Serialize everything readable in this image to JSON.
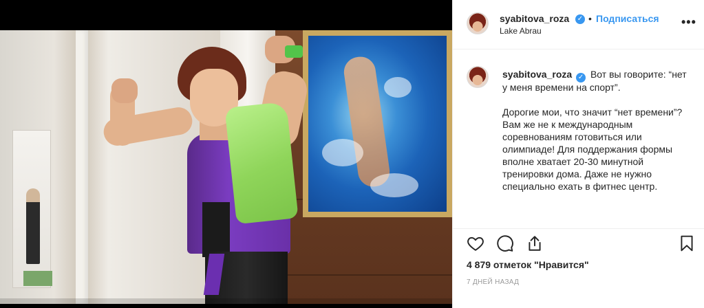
{
  "post": {
    "header": {
      "username": "syabitova_roza",
      "verified_mark": "✓",
      "separator": "•",
      "follow_label": "Подписаться",
      "location": "Lake Abrau",
      "more_label": "•••"
    },
    "caption": {
      "username": "syabitova_roza",
      "first_line": "Вот вы говорите: “нет у меня времени на спорт”.",
      "body": "Дорогие мои, что значит “нет времени”? Вам же не к международным соревнованиям готовиться или олимпиаде! Для поддержания формы вполне хватает 20-30 минутной тренировки дома. Даже не нужно специально ехать в фитнес центр."
    },
    "likes_text": "4 879 отметок \"Нравится\"",
    "timestamp": "7 ДНЕЙ НАЗАД"
  },
  "icons": {
    "like": "heart-icon",
    "comment": "comment-icon",
    "share": "share-icon",
    "save": "bookmark-icon"
  },
  "colors": {
    "accent": "#3897f0",
    "text": "#262626",
    "muted": "#999999",
    "divider": "#efefef"
  }
}
